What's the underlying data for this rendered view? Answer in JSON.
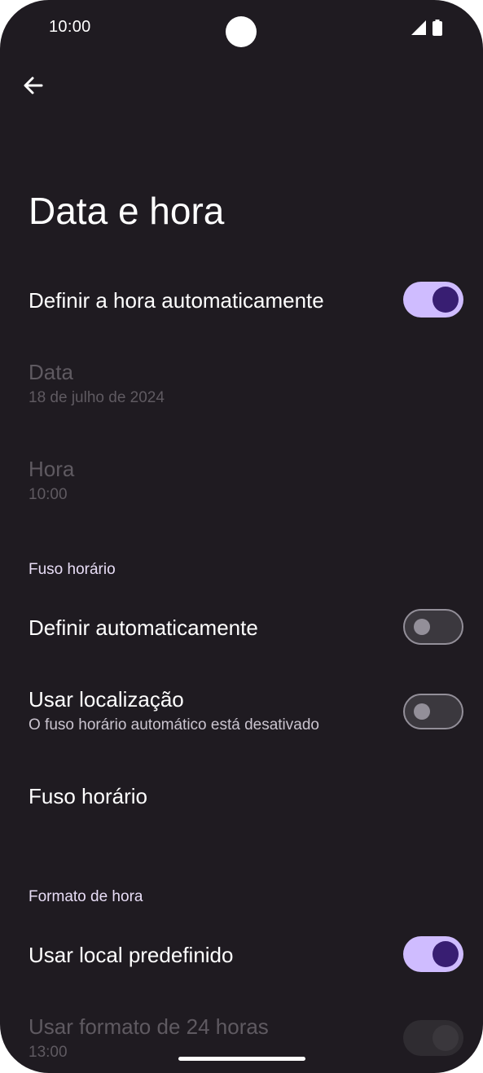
{
  "status_bar": {
    "time": "10:00",
    "icons": [
      "signal-icon",
      "battery-icon"
    ]
  },
  "header": {
    "back_icon": "arrow-left-icon",
    "title": "Data e hora"
  },
  "settings": {
    "auto_time": {
      "label": "Definir a hora automaticamente",
      "enabled": true
    },
    "date": {
      "label": "Data",
      "value": "18 de julho de 2024"
    },
    "time": {
      "label": "Hora",
      "value": "10:00"
    },
    "timezone_section": "Fuso horário",
    "auto_timezone": {
      "label": "Definir automaticamente",
      "enabled": false
    },
    "use_location": {
      "label": "Usar localização",
      "sub": "O fuso horário automático está desativado",
      "enabled": false
    },
    "timezone": {
      "label": "Fuso horário"
    },
    "format_section": "Formato de hora",
    "use_locale": {
      "label": "Usar local predefinido",
      "enabled": true
    },
    "use_24h": {
      "label": "Usar formato de 24 horas",
      "value": "13:00",
      "enabled": true
    }
  },
  "colors": {
    "background": "#1f1b21",
    "accent": "#cfbcff",
    "accent_knob": "#381e72",
    "section_header": "#e8ddf6"
  }
}
